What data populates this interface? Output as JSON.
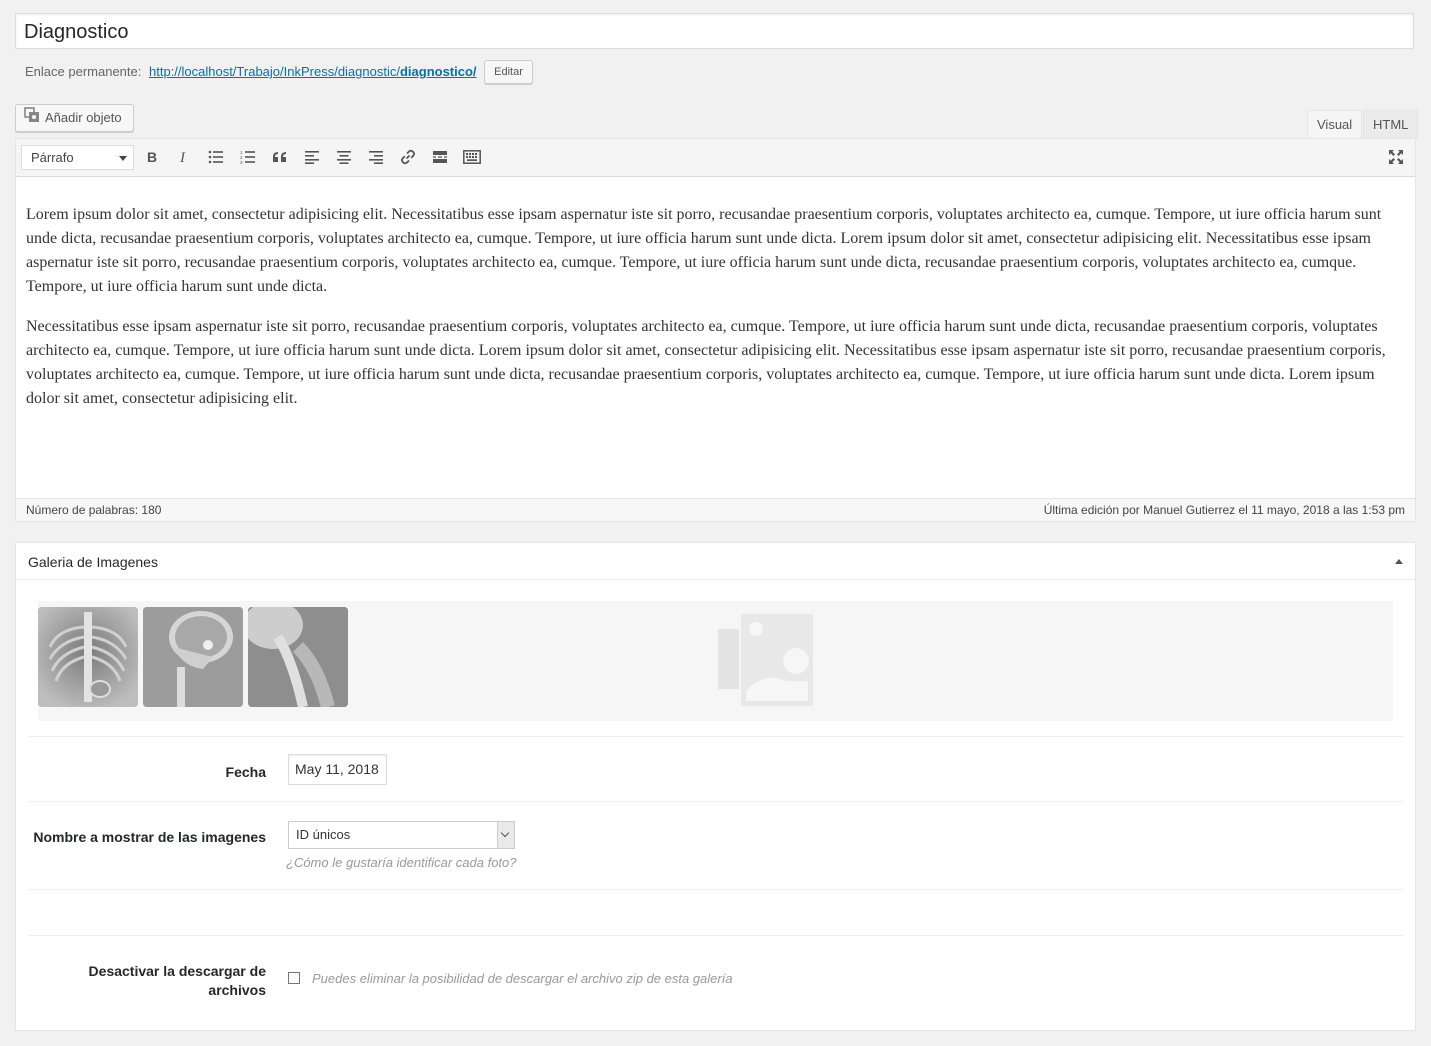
{
  "post": {
    "title": "Diagnostico",
    "permalink_label": "Enlace permanente:",
    "permalink_base": "http://localhost/Trabajo/InkPress/diagnostic/",
    "permalink_slug": "diagnostico/",
    "edit_label": "Editar"
  },
  "editor": {
    "add_media_label": "Añadir objeto",
    "tabs": {
      "visual": "Visual",
      "html": "HTML"
    },
    "format_select": "Párrafo",
    "paragraphs": [
      "Lorem ipsum dolor sit amet, consectetur adipisicing elit. Necessitatibus esse ipsam aspernatur iste sit porro, recusandae praesentium corporis, voluptates architecto ea, cumque. Tempore, ut iure officia harum sunt unde dicta, recusandae praesentium corporis, voluptates architecto ea, cumque. Tempore, ut iure officia harum sunt unde dicta. Lorem ipsum dolor sit amet, consectetur adipisicing elit. Necessitatibus esse ipsam aspernatur iste sit porro, recusandae praesentium corporis, voluptates architecto ea, cumque. Tempore, ut iure officia harum sunt unde dicta, recusandae praesentium corporis, voluptates architecto ea, cumque. Tempore, ut iure officia harum sunt unde dicta.",
      "Necessitatibus esse ipsam aspernatur iste sit porro, recusandae praesentium corporis, voluptates architecto ea, cumque. Tempore, ut iure officia harum sunt unde dicta, recusandae praesentium corporis, voluptates architecto ea, cumque. Tempore, ut iure officia harum sunt unde dicta. Lorem ipsum dolor sit amet, consectetur adipisicing elit. Necessitatibus esse ipsam aspernatur iste sit porro, recusandae praesentium corporis, voluptates architecto ea, cumque. Tempore, ut iure officia harum sunt unde dicta, recusandae praesentium corporis, voluptates architecto ea, cumque. Tempore, ut iure officia harum sunt unde dicta. Lorem ipsum dolor sit amet, consectetur adipisicing elit."
    ],
    "word_count": "Número de palabras: 180",
    "last_edit": "Última edición por Manuel Gutierrez el 11 mayo, 2018 a las 1:53 pm"
  },
  "metabox": {
    "title": "Galeria de Imagenes",
    "date_label": "Fecha",
    "date_value": "May 11, 2018",
    "display_name_label": "Nombre a mostrar de las imagenes",
    "display_name_value": "ID únicos",
    "display_name_help": "¿Cómo le gustaría identificar cada foto?",
    "disable_download_label": "Desactivar la descargar de archivos",
    "disable_download_help": "Puedes eliminar la posibilidad de descargar el archivo zip de esta galería"
  },
  "colors": {
    "link": "#0073aa",
    "background": "#f1f1f1"
  }
}
